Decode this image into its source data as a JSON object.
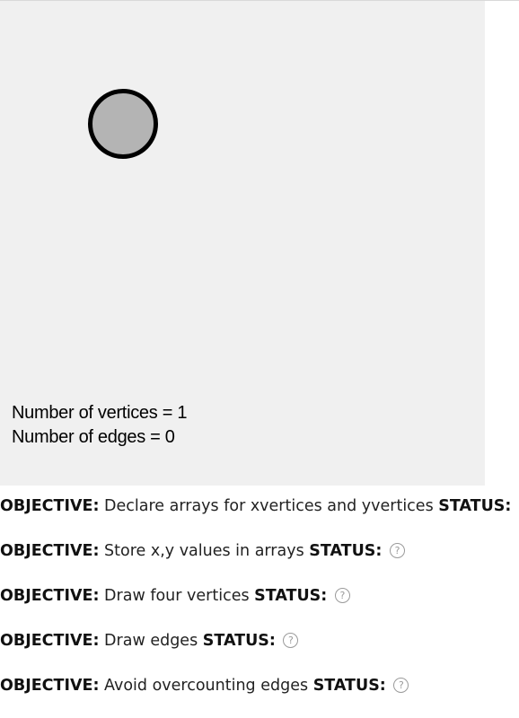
{
  "canvas": {
    "vertex_count_text": "Number of vertices = 1",
    "edge_count_text": "Number of edges = 0",
    "vertices": [
      {
        "fill": "#b4b4b4",
        "stroke": "#000000"
      }
    ]
  },
  "objectives": {
    "objective_label": "OBJECTIVE:",
    "status_label": "STATUS:",
    "status_icon": "help-circle-icon",
    "items": [
      {
        "text": "Declare arrays for xvertices and yvertices"
      },
      {
        "text": "Store x,y values in arrays"
      },
      {
        "text": "Draw four vertices"
      },
      {
        "text": "Draw edges"
      },
      {
        "text": "Avoid overcounting edges"
      }
    ]
  },
  "colors": {
    "canvas_background": "#f0f0f0",
    "status_icon": "#9a9a9a"
  }
}
